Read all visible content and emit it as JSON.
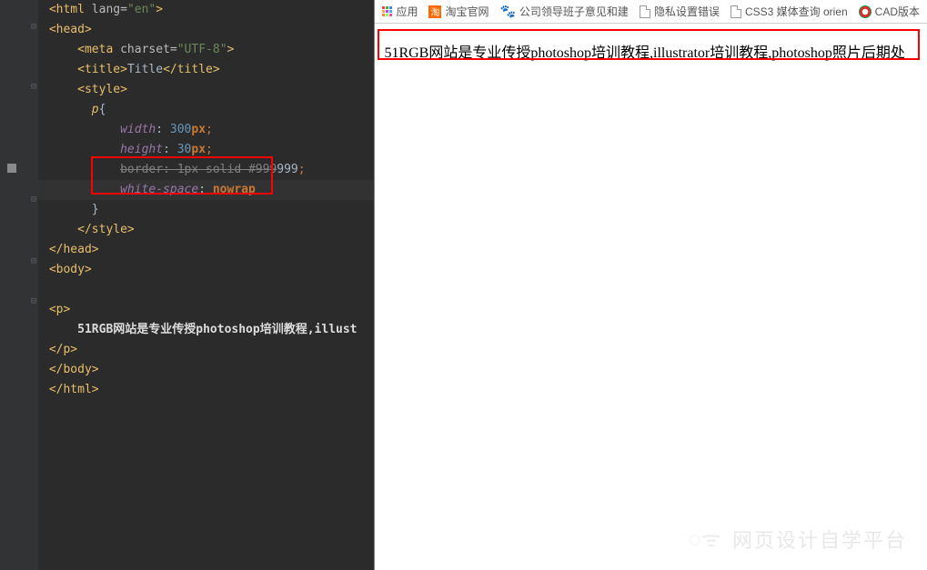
{
  "code": {
    "line1_tag": "<html ",
    "line1_attr": "lang=",
    "line1_str": "\"en\"",
    "line1_end": ">",
    "line2": "<head>",
    "line3_a": "<meta ",
    "line3_b": "charset=",
    "line3_c": "\"UTF-8\"",
    "line3_d": ">",
    "line4_a": "<title>",
    "line4_b": "Title",
    "line4_c": "</title>",
    "line5": "<style>",
    "line6_sel": "p",
    "line6_brace": "{",
    "line7_prop": "width",
    "line7_colon": ": ",
    "line7_val": "300",
    "line7_unit": "px",
    "line7_semi": ";",
    "line8_prop": "height",
    "line8_val": "30",
    "line8_unit": "px",
    "line9_strike": "border: 1px solid #999",
    "line9_rest": "999",
    "line9_semi": ";",
    "line10_prop": "white-space",
    "line10_val": "nowrap",
    "line11": "}",
    "line12": "</style>",
    "line13": "</head>",
    "line14": "<body>",
    "line16": "<p>",
    "line17": "51RGB网站是专业传授photoshop培训教程,illust",
    "line18": "</p>",
    "line19": "</body>",
    "line20": "</html>"
  },
  "bookmarks": {
    "apps": "应用",
    "taobao": "淘宝官网",
    "company": "公司领导班子意见和建",
    "privacy": "隐私设置错误",
    "css3": "CSS3 媒体查询 orien",
    "cad": "CAD版本"
  },
  "render": {
    "text": "51RGB网站是专业传授photoshop培训教程,illustrator培训教程,photoshop照片后期处"
  },
  "watermark": {
    "text": "网页设计自学平台"
  }
}
